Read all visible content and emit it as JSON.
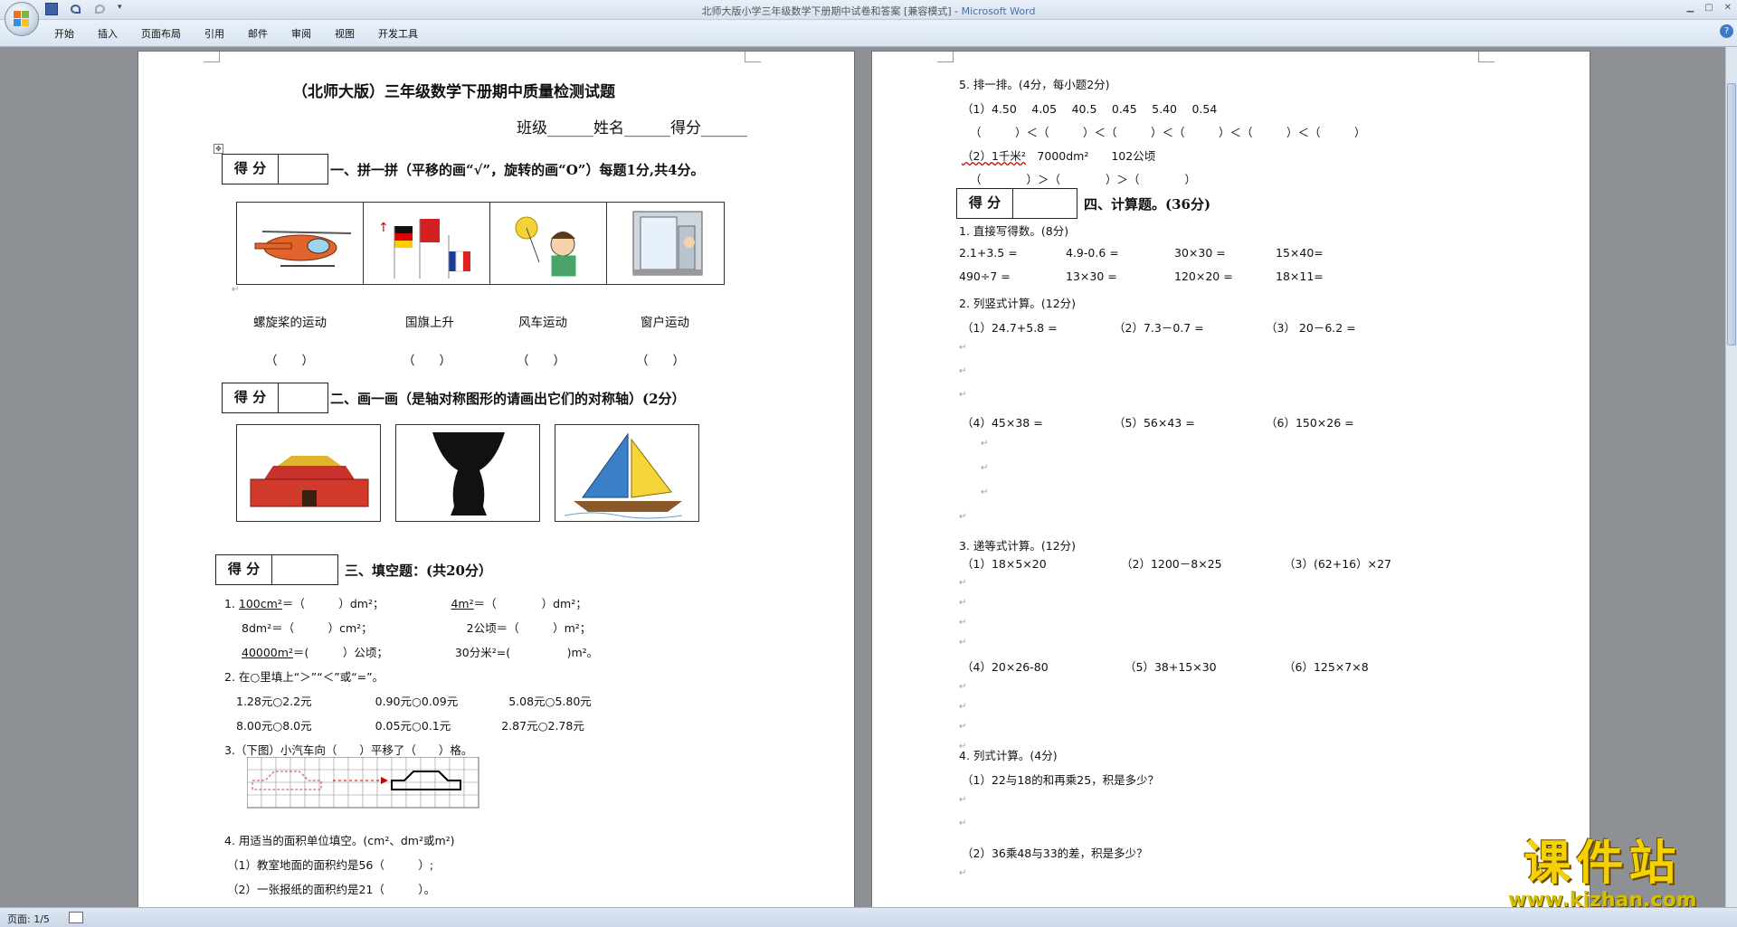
{
  "window": {
    "title": "北师大版小学三年级数学下册期中试卷和答案 [兼容模式]",
    "title_sep": " - ",
    "app_name": "Microsoft Word",
    "qat_more": "▾"
  },
  "ribbon": {
    "tabs": [
      "开始",
      "插入",
      "页面布局",
      "引用",
      "邮件",
      "审阅",
      "视图",
      "开发工具"
    ],
    "help": "?"
  },
  "status": {
    "page": "页面: 1/5"
  },
  "page1": {
    "title": "（北师大版）三年级数学下册期中质量检测试题",
    "class_line": "班级______姓名______得分______",
    "score_label": "得 分",
    "sec1_title": "一、拼一拼（平移的画“√”，旋转的画“O”）每题1分,共4分。",
    "captions": [
      "螺旋桨的运动",
      "国旗上升",
      "风车运动",
      "窗户运动"
    ],
    "answer_blank": "（　　）",
    "sec2_title": "二、画一画（是轴对称图形的请画出它们的对称轴）(2分）",
    "sec3_title": "三、填空题：(共20分）",
    "q1_lines": [
      [
        "1. ",
        "100cm²",
        "＝（　　　）dm²；",
        "4m²",
        "＝（　　　　）dm²；"
      ],
      [
        "",
        "8dm²",
        "＝（　　　）cm²；",
        "2公顷",
        "＝（　　　）m²；"
      ],
      [
        "",
        "40000m²",
        "＝(　　　）公顷；",
        "30分米²",
        "=(　　　　　)m²。"
      ]
    ],
    "q2_title": "2. 在○里填上“＞”“＜”或“=”。",
    "q2_rows": [
      [
        "1.28元○2.2元",
        "0.90元○0.09元",
        "5.08元○5.80元"
      ],
      [
        "8.00元○8.0元",
        "0.05元○0.1元",
        "2.87元○2.78元"
      ]
    ],
    "q3": "3.（下图）小汽车向（　　）平移了（　　）格。",
    "q4_title": "4. 用适当的面积单位填空。(cm²、dm²或m²)",
    "q4_items": [
      "（1）教室地面的面积约是56（　　　）;",
      "（2）一张报纸的面积约是21（　　　）。"
    ]
  },
  "page2": {
    "q5_title": "5. 排一排。(4分，每小题2分)",
    "q5_1": "（1）4.50　 4.05　 40.5　 0.45　 5.40　 0.54",
    "q5_1_blanks": "（　　　）＜（　　　）＜（　　　）＜（　　　）＜（　　　）＜（　　　）",
    "q5_2_a": "（2）1千米²",
    "q5_2_b": "　7000dm²　　102公顷",
    "q5_2_blanks": "（　　　　）＞（　　　　）＞（　　　　）",
    "score_label": "得 分",
    "sec4_title": "四、计算题。(36分)",
    "c1_title": "1. 直接写得数。(8分)",
    "c1_rows": [
      [
        "2.1+3.5 =",
        "4.9-0.6 =",
        "30×30 =",
        "15×40="
      ],
      [
        "490÷7 =",
        "13×30 =",
        "120×20 =",
        "18×11="
      ]
    ],
    "c2_title": "2. 列竖式计算。(12分)",
    "c2_row1": [
      "（1）24.7+5.8 =",
      "（2）7.3－0.7 =",
      "（3） 20－6.2 ="
    ],
    "c2_row2": [
      "（4）45×38 =",
      "（5）56×43 =",
      "（6）150×26 ="
    ],
    "c3_title": "3. 递等式计算。(12分)",
    "c3_row1": [
      "（1）18×5×20",
      "（2）1200－8×25",
      "（3）(62+16）×27"
    ],
    "c3_row2": [
      "（4）20×26-80",
      "（5）38+15×30",
      "（6）125×7×8"
    ],
    "c4_title": "4. 列式计算。(4分)",
    "c4_1": "（1）22与18的和再乘25，积是多少？",
    "c4_2": "（2）36乘48与33的差，积是多少？"
  },
  "watermark": {
    "text": "课件站",
    "url": "www.kjzhan.com"
  }
}
